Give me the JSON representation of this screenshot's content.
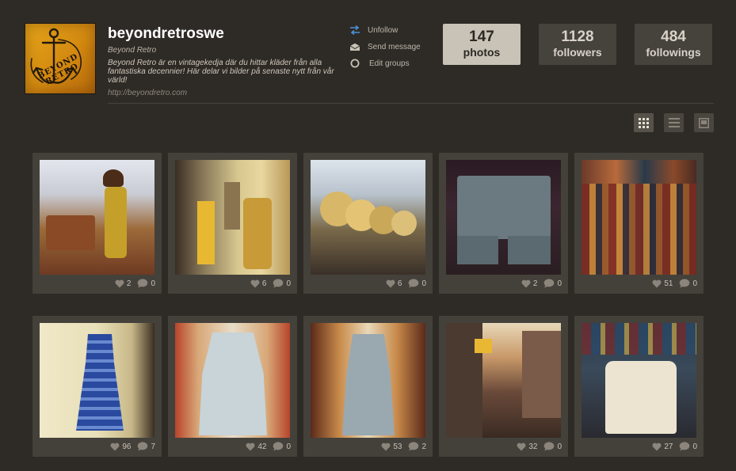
{
  "profile": {
    "username": "beyondretroswe",
    "full_name": "Beyond Retro",
    "bio": "Beyond Retro är en vintagekedja där du hittar kläder från alla fantastiska decennier! Här delar vi bilder på senaste nytt från vår värld!",
    "website": "http://beyondretro.com",
    "avatar_text": "BEYOND RETRO"
  },
  "actions": [
    {
      "label": "Unfollow",
      "icon": "swap-arrows-icon"
    },
    {
      "label": "Send message",
      "icon": "envelope-icon"
    },
    {
      "label": "Edit groups",
      "icon": "circle-icon"
    }
  ],
  "stats": [
    {
      "count": "147",
      "label": "photos"
    },
    {
      "count": "1128",
      "label": "followers"
    },
    {
      "count": "484",
      "label": "followings"
    }
  ],
  "view_modes": [
    "grid-view-icon",
    "list-view-icon",
    "single-view-icon"
  ],
  "photos": [
    {
      "likes": "2",
      "comments": "0"
    },
    {
      "likes": "6",
      "comments": "0"
    },
    {
      "likes": "6",
      "comments": "0"
    },
    {
      "likes": "2",
      "comments": "0"
    },
    {
      "likes": "51",
      "comments": "0"
    },
    {
      "likes": "96",
      "comments": "7"
    },
    {
      "likes": "42",
      "comments": "0"
    },
    {
      "likes": "53",
      "comments": "2"
    },
    {
      "likes": "32",
      "comments": "0"
    },
    {
      "likes": "27",
      "comments": "0"
    }
  ],
  "colors": {
    "background": "#2e2a26",
    "card": "#44413b",
    "stat_active": "#c9c3b7",
    "accent_blue": "#4d8fd6",
    "avatar_orange": "#e0a018"
  }
}
